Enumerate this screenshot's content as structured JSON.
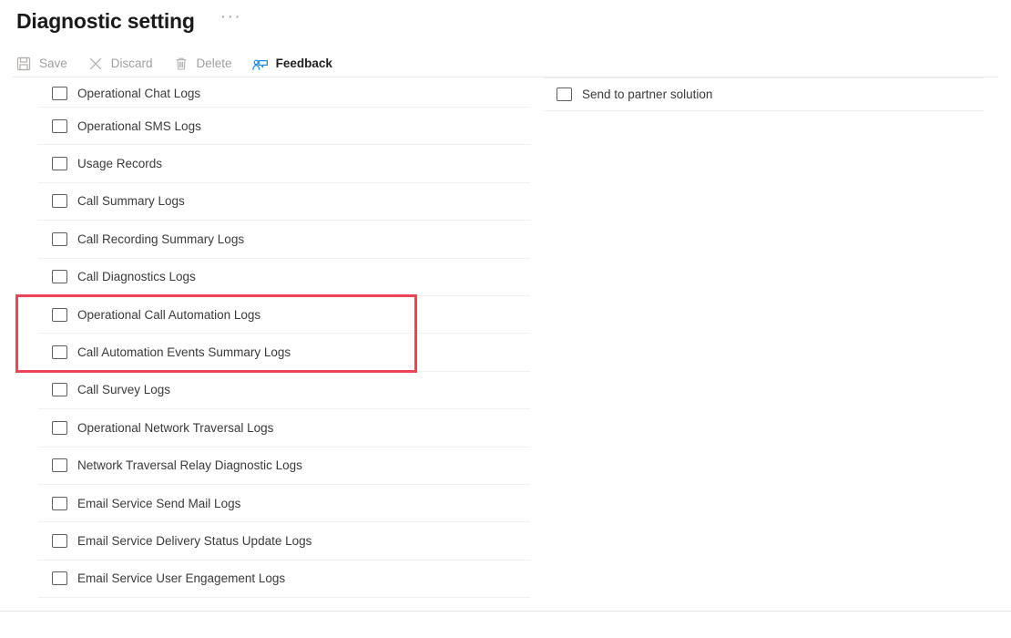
{
  "header": {
    "title": "Diagnostic setting",
    "more_label": "···"
  },
  "command_bar": {
    "items": [
      {
        "label": "Save",
        "icon": "save-icon",
        "enabled": false
      },
      {
        "label": "Discard",
        "icon": "close-icon",
        "enabled": false
      },
      {
        "label": "Delete",
        "icon": "trash-icon",
        "enabled": false
      },
      {
        "label": "Feedback",
        "icon": "feedback-icon",
        "enabled": true
      }
    ]
  },
  "left_column": {
    "rows": [
      {
        "label": "Operational Chat Logs",
        "checked": false
      },
      {
        "label": "Operational SMS Logs",
        "checked": false
      },
      {
        "label": "Usage Records",
        "checked": false
      },
      {
        "label": "Call Summary Logs",
        "checked": false
      },
      {
        "label": "Call Recording Summary Logs",
        "checked": false
      },
      {
        "label": "Call Diagnostics Logs",
        "checked": false
      },
      {
        "label": "Operational Call Automation Logs",
        "checked": false
      },
      {
        "label": "Call Automation Events Summary Logs",
        "checked": false
      },
      {
        "label": "Call Survey Logs",
        "checked": false
      },
      {
        "label": "Operational Network Traversal Logs",
        "checked": false
      },
      {
        "label": "Network Traversal Relay Diagnostic Logs",
        "checked": false
      },
      {
        "label": "Email Service Send Mail Logs",
        "checked": false
      },
      {
        "label": "Email Service Delivery Status Update Logs",
        "checked": false
      },
      {
        "label": "Email Service User Engagement Logs",
        "checked": false
      }
    ]
  },
  "right_column": {
    "rows": [
      {
        "label": "Send to partner solution",
        "checked": false
      }
    ]
  },
  "annotation": {
    "color": "#ee4257",
    "highlighted_labels": [
      "Operational Call Automation Logs",
      "Call Automation Events Summary Logs"
    ]
  },
  "colors": {
    "accent": "#0078d4",
    "text": "#323130",
    "disabled_text": "#a19f9d",
    "divider": "#edebe9",
    "annotation_red": "#ee4257"
  }
}
